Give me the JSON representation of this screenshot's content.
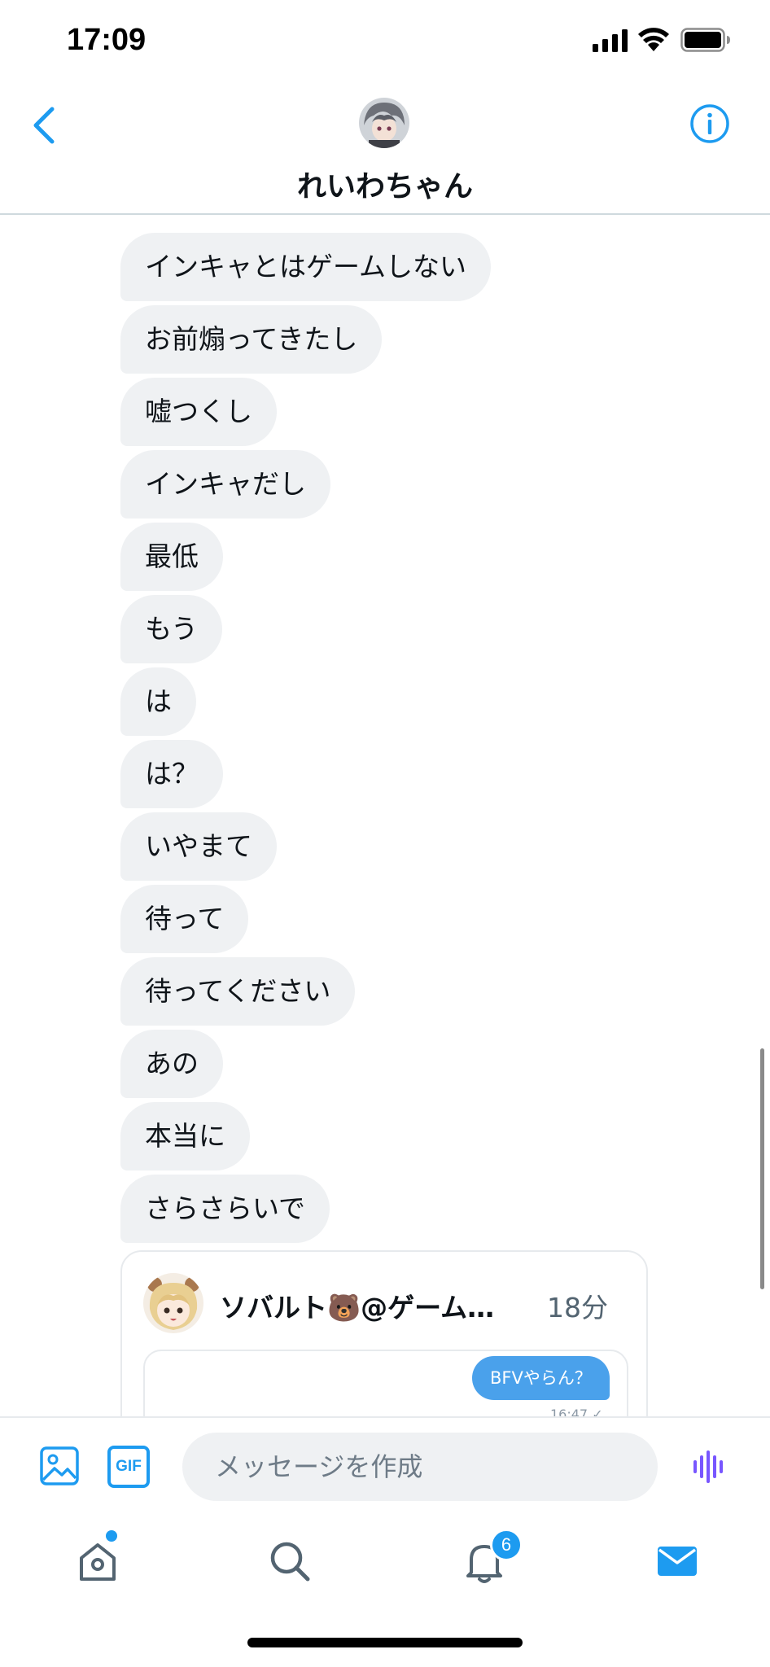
{
  "status_bar": {
    "time": "17:09"
  },
  "header": {
    "title": "れいわちゃん"
  },
  "messages": [
    "インキャとはゲームしない",
    "お前煽ってきたし",
    "嘘つくし",
    "インキャだし",
    "最低",
    "もう",
    "は",
    "は？",
    "いやまて",
    "待って",
    "待ってください",
    "あの",
    "本当に",
    "さらさらいで"
  ],
  "shared_card": {
    "name": "ソバルト🐻@ゲーム…",
    "time": "18分",
    "preview_message": "BFVやらん？",
    "preview_time": "16:47 ✓"
  },
  "composer": {
    "placeholder": "メッセージを作成",
    "gif_label": "GIF"
  },
  "tab_bar": {
    "notification_count": "6"
  },
  "colors": {
    "accent": "#1d9bf0",
    "bubble_received": "#eff1f3",
    "voice": "#7856ff"
  },
  "icons": [
    "back-icon",
    "info-icon",
    "media-icon",
    "voice-icon",
    "home-icon",
    "search-icon",
    "bell-icon",
    "mail-icon"
  ]
}
